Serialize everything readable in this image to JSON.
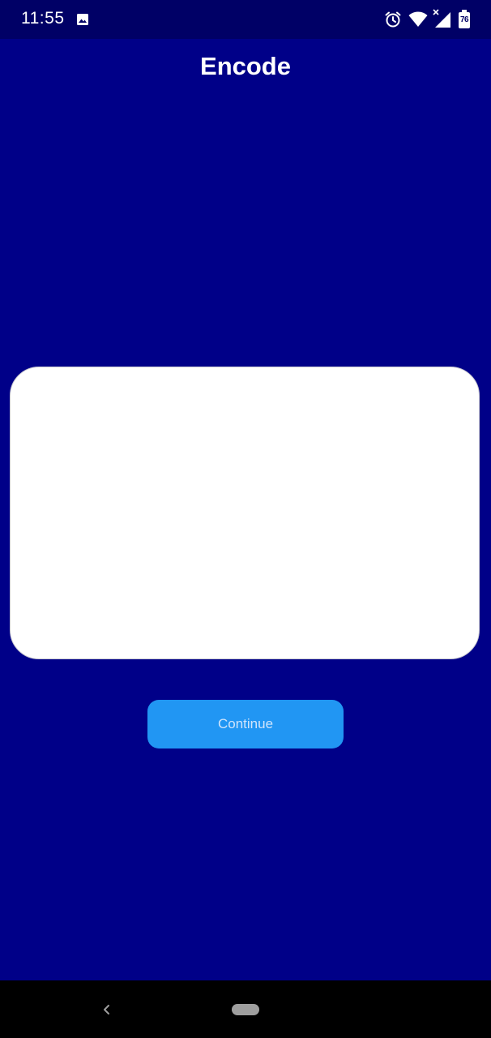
{
  "status_bar": {
    "time": "11:55",
    "battery_level": "76",
    "icons": [
      "image-icon",
      "alarm-icon",
      "wifi-icon",
      "cellular-no-data-icon",
      "battery-icon"
    ]
  },
  "app_bar": {
    "title": "Encode"
  },
  "main": {
    "text_area_value": "",
    "continue_label": "Continue"
  },
  "nav_bar": {
    "icons": [
      "back-icon",
      "home-icon"
    ]
  },
  "colors": {
    "background": "#000088",
    "status_bar": "#000066",
    "button": "#2196f3",
    "button_text": "#cfe4fb",
    "nav_bar": "#000000"
  }
}
